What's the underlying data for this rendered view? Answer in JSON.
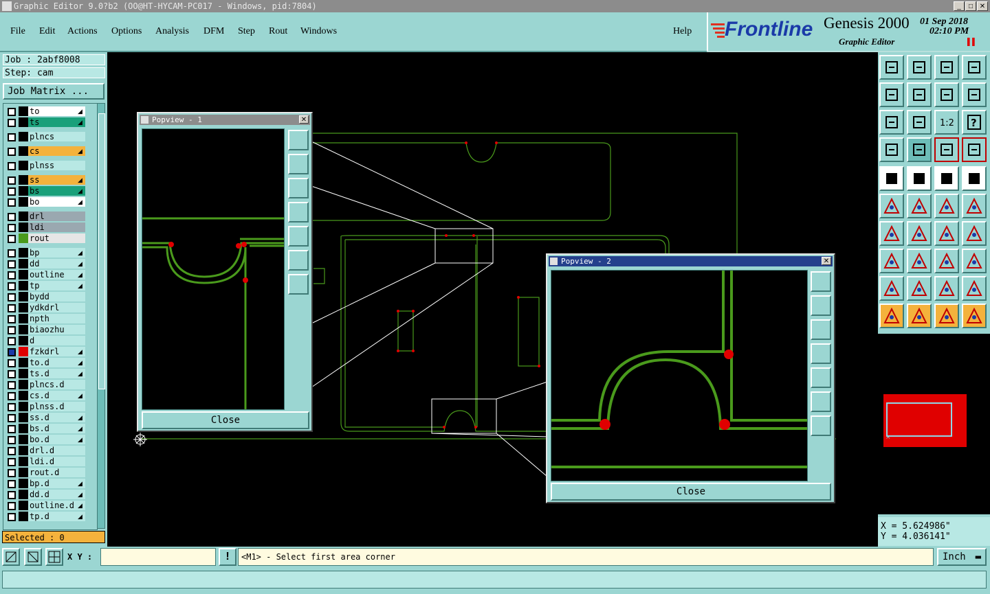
{
  "window": {
    "title": "Graphic Editor 9.0?b2 (OO@HT-HYCAM-PC017 - Windows, pid:7804)"
  },
  "menu": [
    {
      "label": "File"
    },
    {
      "label": "Edit"
    },
    {
      "label": "Actions"
    },
    {
      "label": "Options"
    },
    {
      "label": "Analysis"
    },
    {
      "label": "DFM"
    },
    {
      "label": "Step"
    },
    {
      "label": "Rout"
    },
    {
      "label": "Windows"
    },
    {
      "label": "Help"
    }
  ],
  "brand": {
    "logo": "Frontline",
    "product": "Genesis 2000",
    "subtitle": "Graphic Editor",
    "date": "01 Sep 2018",
    "time": "02:10 PM",
    "pause_icon": "pause-icon"
  },
  "job": {
    "job_line": "Job : 2abf8008",
    "step_line": "Step: cam",
    "matrix_button": "Job Matrix ..."
  },
  "layers": [
    {
      "name": "to",
      "color": "#ffffff",
      "arrow": true
    },
    {
      "name": "ts",
      "color": "#1aa07a",
      "arrow": true
    },
    {
      "name": "plncs",
      "color": "#b8e8e4",
      "arrow": false
    },
    {
      "name": "cs",
      "color": "#f4b23c",
      "arrow": true
    },
    {
      "name": "plnss",
      "color": "#b8e8e4",
      "arrow": false
    },
    {
      "name": "ss",
      "color": "#f4b23c",
      "arrow": true
    },
    {
      "name": "bs",
      "color": "#1aa07a",
      "arrow": true
    },
    {
      "name": "bo",
      "color": "#ffffff",
      "arrow": true
    },
    {
      "name": "drl",
      "color": "#9aa8b0",
      "arrow": false
    },
    {
      "name": "ldi",
      "color": "#9aa8b0",
      "arrow": false
    },
    {
      "name": "rout",
      "color": "#e6e6e6",
      "arrow": false
    },
    {
      "name": "bp",
      "color": "#b8e8e4",
      "arrow": true
    },
    {
      "name": "dd",
      "color": "#b8e8e4",
      "arrow": true
    },
    {
      "name": "outline",
      "color": "#b8e8e4",
      "arrow": true
    },
    {
      "name": "tp",
      "color": "#b8e8e4",
      "arrow": true
    },
    {
      "name": "bydd",
      "color": "#b8e8e4",
      "arrow": false
    },
    {
      "name": "ydkdrl",
      "color": "#b8e8e4",
      "arrow": false
    },
    {
      "name": "npth",
      "color": "#b8e8e4",
      "arrow": false
    },
    {
      "name": "biaozhu",
      "color": "#b8e8e4",
      "arrow": false
    },
    {
      "name": "d",
      "color": "#b8e8e4",
      "arrow": false
    },
    {
      "name": "fzkdrl",
      "color": "#b8e8e4",
      "arrow": true
    },
    {
      "name": "to.d",
      "color": "#b8e8e4",
      "arrow": true
    },
    {
      "name": "ts.d",
      "color": "#b8e8e4",
      "arrow": true
    },
    {
      "name": "plncs.d",
      "color": "#b8e8e4",
      "arrow": false
    },
    {
      "name": "cs.d",
      "color": "#b8e8e4",
      "arrow": true
    },
    {
      "name": "plnss.d",
      "color": "#b8e8e4",
      "arrow": false
    },
    {
      "name": "ss.d",
      "color": "#b8e8e4",
      "arrow": true
    },
    {
      "name": "bs.d",
      "color": "#b8e8e4",
      "arrow": true
    },
    {
      "name": "bo.d",
      "color": "#b8e8e4",
      "arrow": true
    },
    {
      "name": "drl.d",
      "color": "#b8e8e4",
      "arrow": false
    },
    {
      "name": "ldi.d",
      "color": "#b8e8e4",
      "arrow": false
    },
    {
      "name": "rout.d",
      "color": "#b8e8e4",
      "arrow": false
    },
    {
      "name": "bp.d",
      "color": "#b8e8e4",
      "arrow": true
    },
    {
      "name": "dd.d",
      "color": "#b8e8e4",
      "arrow": true
    },
    {
      "name": "outline.d",
      "color": "#b8e8e4",
      "arrow": true
    },
    {
      "name": "tp.d",
      "color": "#b8e8e4",
      "arrow": true
    }
  ],
  "selected": "Selected : 0",
  "popview1": {
    "title": "Popview - 1",
    "close": "Close"
  },
  "popview2": {
    "title": "Popview - 2",
    "close": "Close"
  },
  "toolbar_icons": [
    "zoom-home-icon",
    "zoom-in-icon",
    "home-icon",
    "fit-window-icon",
    "pan-left-icon",
    "pan-right-icon",
    "undo-zoom-icon",
    "redraw-icon",
    "zoom-fit-icon",
    "zoom-center-icon",
    "scale-1-2-icon",
    "help-icon",
    "snap-icon",
    "grid-icon",
    "layer-display-icon",
    "layer-features-icon",
    "select-icon",
    "measure-icon",
    "ruler-icon",
    "pad-icon",
    "connect-icon",
    "delete-icon",
    "move-icon",
    "copy-icon",
    "angle-icon",
    "line-icon",
    "arc-icon",
    "fill-icon",
    "transform-icon",
    "split-icon",
    "distance-icon",
    "group-icon",
    "triangle-icon",
    "triangle-outline-icon",
    "bridge-icon",
    "bridge-outline-icon",
    "pointer-icon",
    "pointer-box-icon",
    "pointer-select-icon",
    "route-icon"
  ],
  "toolbar_labels": {
    "scale": "1:2",
    "help": "?"
  },
  "coords": {
    "x": "X  =  5.624986\"",
    "y": "Y  =  4.036141\""
  },
  "status": {
    "xy_label": "X Y :",
    "message": "<M1> - Select first area corner",
    "unit": "Inch",
    "warn_icon": "exclamation-icon"
  },
  "colors": {
    "panel": "#9bd6d2",
    "trace": "#4a9a1c",
    "pad": "#e00000",
    "highlight": "#f4b23c"
  }
}
